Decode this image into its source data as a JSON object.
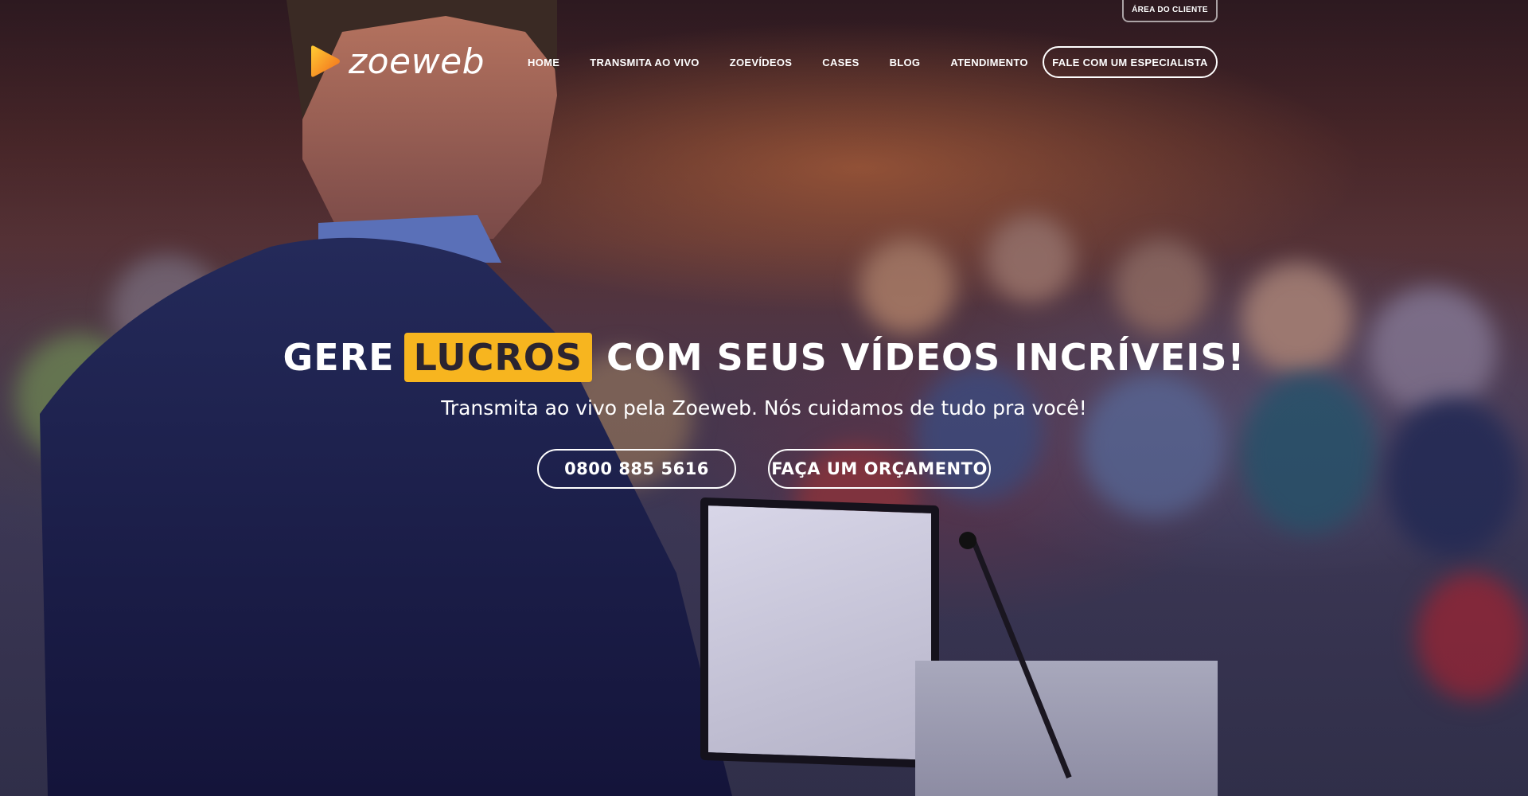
{
  "top_bar": {
    "client_area_label": "ÁREA DO CLIENTE"
  },
  "logo": {
    "text": "zoeweb",
    "icon": "play-triangle-icon",
    "icon_color": "#f7931e"
  },
  "nav": {
    "items": [
      {
        "label": "HOME"
      },
      {
        "label": "TRANSMITA AO VIVO"
      },
      {
        "label": "ZOEVÍDEOS"
      },
      {
        "label": "CASES"
      },
      {
        "label": "BLOG"
      },
      {
        "label": "ATENDIMENTO"
      }
    ],
    "cta_label": "FALE COM UM ESPECIALISTA"
  },
  "hero": {
    "headline_before": "GERE",
    "headline_highlight": "LUCROS",
    "headline_after": "COM SEUS VÍDEOS INCRÍVEIS!",
    "highlight_color": "#f7b51f",
    "subheadline": "Transmita ao vivo pela Zoeweb. Nós cuidamos de tudo pra você!",
    "phone_button_label": "0800 885 5616",
    "quote_button_label": "FAÇA UM ORÇAMENTO"
  }
}
